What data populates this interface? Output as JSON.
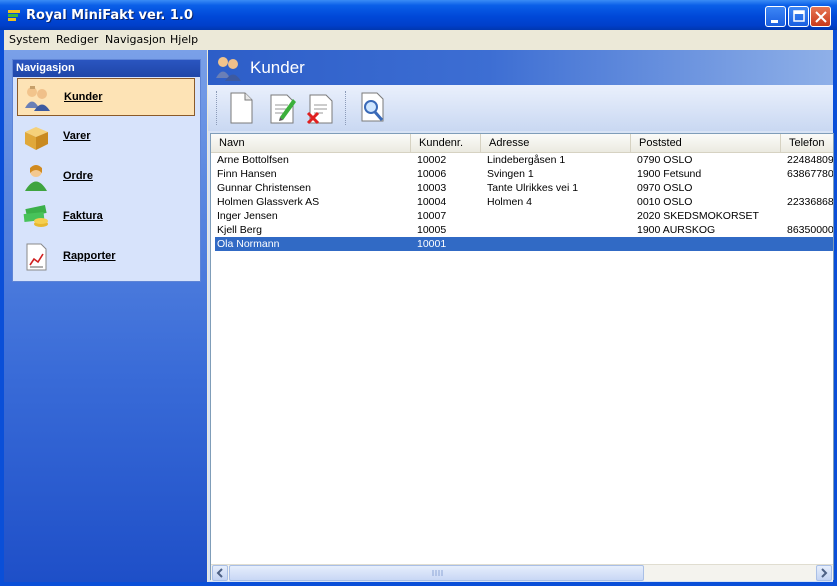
{
  "window": {
    "title": "Royal MiniFakt ver. 1.0"
  },
  "menu": [
    "System",
    "Rediger",
    "Navigasjon",
    "Hjelp"
  ],
  "nav": {
    "header": "Navigasjon",
    "items": [
      {
        "label": "Kunder",
        "icon": "customers-icon",
        "active": true
      },
      {
        "label": "Varer",
        "icon": "box-icon",
        "active": false
      },
      {
        "label": "Ordre",
        "icon": "person-orders-icon",
        "active": false
      },
      {
        "label": "Faktura",
        "icon": "money-icon",
        "active": false
      },
      {
        "label": "Rapporter",
        "icon": "report-chart-icon",
        "active": false
      }
    ]
  },
  "page": {
    "title": "Kunder"
  },
  "toolbar": [
    "new-document-icon",
    "edit-document-icon",
    "delete-document-icon",
    "search-document-icon"
  ],
  "table": {
    "columns": [
      "Navn",
      "Kundenr.",
      "Adresse",
      "Poststed",
      "Telefon"
    ],
    "rows": [
      [
        "Arne Bottolfsen",
        "10002",
        "Lindebergåsen 1",
        "0790 OSLO",
        "22484809"
      ],
      [
        "Finn Hansen",
        "10006",
        "Svingen 1",
        "1900 Fetsund",
        "63867780"
      ],
      [
        "Gunnar Christensen",
        "10003",
        "Tante Ulrikkes vei 1",
        "0970 OSLO",
        ""
      ],
      [
        "Holmen Glassverk AS",
        "10004",
        "Holmen 4",
        "0010 OSLO",
        "22336868"
      ],
      [
        "Inger Jensen",
        "10007",
        "",
        "2020 SKEDSMOKORSET",
        ""
      ],
      [
        "Kjell Berg",
        "10005",
        "",
        "1900 AURSKOG",
        "86350000"
      ],
      [
        "Ola Normann",
        "10001",
        "",
        "",
        ""
      ]
    ],
    "selected_row": 6
  },
  "colors": {
    "titlebar": "#0048d8",
    "selection": "#316ac5",
    "nav_active": "#fde3b5"
  }
}
